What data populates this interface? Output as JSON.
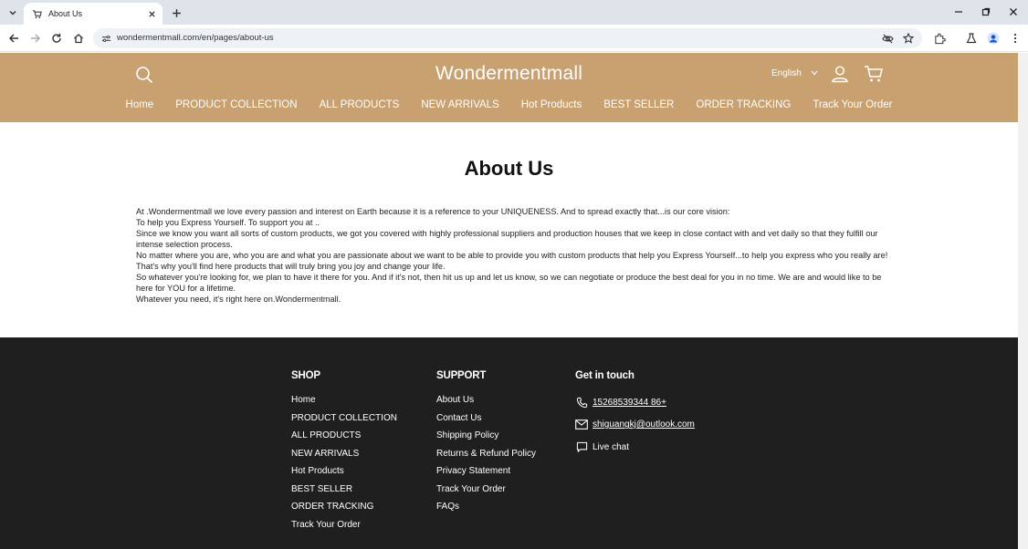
{
  "browser": {
    "tab_title": "About Us",
    "url": "wondermentmall.com/en/pages/about-us"
  },
  "header": {
    "logo": "Wondermentmall",
    "language": "English",
    "nav": [
      "Home",
      "PRODUCT COLLECTION",
      "ALL PRODUCTS",
      "NEW ARRIVALS",
      "Hot Products",
      "BEST SELLER",
      "ORDER TRACKING",
      "Track Your Order"
    ]
  },
  "main": {
    "title": "About Us",
    "paragraphs": [
      "At .Wondermentmall we love every passion and interest on Earth because it is a reference to your UNIQUENESS. And to spread exactly that...is our core vision:",
      "To help you Express Yourself. To support you at ..",
      "Since we know you want all sorts of custom products, we got you covered with highly professional suppliers and production houses that we keep in close contact with and vet daily so that they fulfill our intense selection process.",
      "No matter where you are, who you are and what you are passionate about we want to be able to provide you with custom products that help you Express Yourself...to help you express who you really are!",
      "That's why you'll find here products that will truly bring you joy and change your life.",
      "So whatever you're looking for, we plan to have it there for you. And if it's not, then hit us up and let us know, so we can negotiate or produce the best deal for you in no time. We are and would like to be here for YOU for a lifetime.",
      "Whatever you need, it's right here on.Wondermentmall."
    ]
  },
  "footer": {
    "shop": {
      "heading": "SHOP",
      "links": [
        "Home",
        "PRODUCT COLLECTION",
        "ALL PRODUCTS",
        "NEW ARRIVALS",
        "Hot Products",
        "BEST SELLER",
        "ORDER TRACKING",
        "Track Your Order"
      ]
    },
    "support": {
      "heading": "SUPPORT",
      "links": [
        "About Us",
        "Contact Us",
        "Shipping Policy",
        "Returns & Refund Policy",
        "Privacy Statement",
        "Track Your Order",
        "FAQs"
      ]
    },
    "contact": {
      "heading": "Get in touch",
      "phone": "15268539344 86+",
      "email": "shiguangkj@outlook.com",
      "chat": "Live chat"
    }
  },
  "colors": {
    "header_bg": "#c9a06f",
    "footer_bg": "#1f1f1f"
  }
}
